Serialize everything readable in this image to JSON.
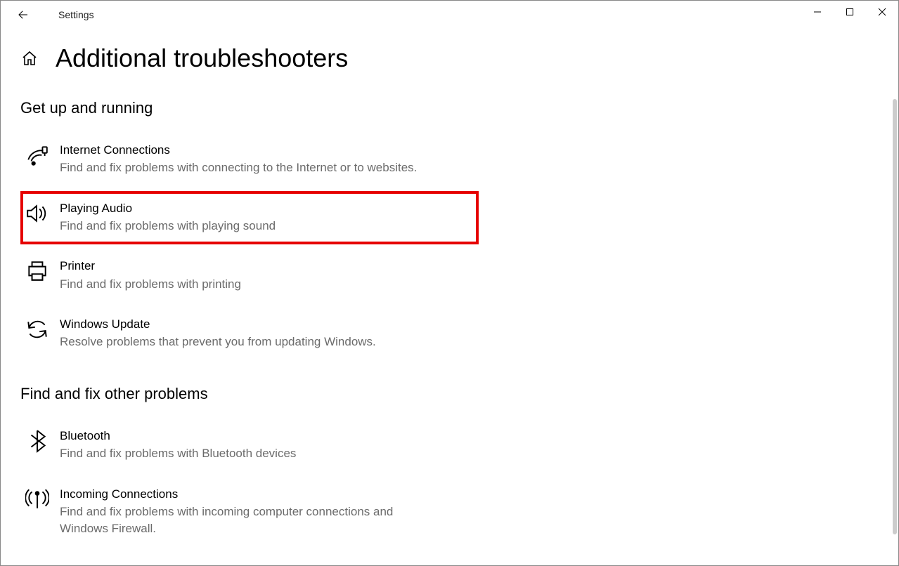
{
  "app_title": "Settings",
  "page_title": "Additional troubleshooters",
  "sections": [
    {
      "title": "Get up and running",
      "items": [
        {
          "icon": "internet",
          "title": "Internet Connections",
          "desc": "Find and fix problems with connecting to the Internet or to websites.",
          "highlighted": false
        },
        {
          "icon": "audio",
          "title": "Playing Audio",
          "desc": "Find and fix problems with playing sound",
          "highlighted": true
        },
        {
          "icon": "printer",
          "title": "Printer",
          "desc": "Find and fix problems with printing",
          "highlighted": false
        },
        {
          "icon": "update",
          "title": "Windows Update",
          "desc": "Resolve problems that prevent you from updating Windows.",
          "highlighted": false
        }
      ]
    },
    {
      "title": "Find and fix other problems",
      "items": [
        {
          "icon": "bluetooth",
          "title": "Bluetooth",
          "desc": "Find and fix problems with Bluetooth devices",
          "highlighted": false
        },
        {
          "icon": "incoming",
          "title": "Incoming Connections",
          "desc": "Find and fix problems with incoming computer connections and Windows Firewall.",
          "highlighted": false
        }
      ]
    }
  ]
}
